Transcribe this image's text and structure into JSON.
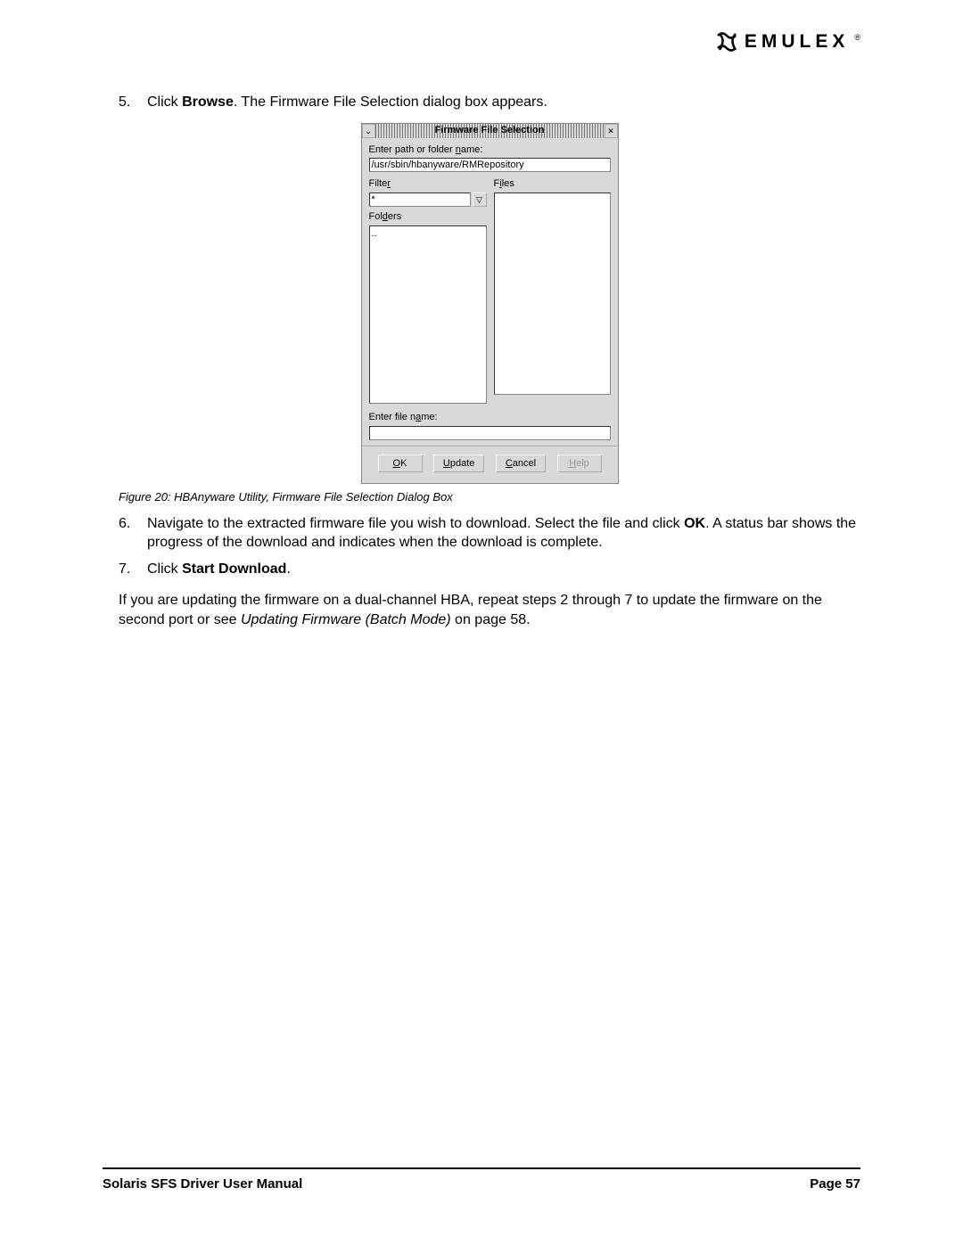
{
  "brand": {
    "name": "EMULEX",
    "reg": "®"
  },
  "steps": {
    "s5": {
      "num": "5.",
      "pre": "Click ",
      "bold": "Browse",
      "post": ". The Firmware File Selection dialog box appears."
    },
    "s6": {
      "num": "6.",
      "pre": "Navigate to the extracted firmware file you wish to download. Select the file and click ",
      "bold": "OK",
      "post": ". A status bar shows the progress of the download and indicates when the download is complete."
    },
    "s7": {
      "num": "7.",
      "pre": "Click ",
      "bold": "Start Download",
      "post": "."
    }
  },
  "dialog": {
    "title": "Firmware File Selection",
    "path_label_pre": "Enter path or folder ",
    "path_label_u": "n",
    "path_label_post": "ame:",
    "path_value": "/usr/sbin/hbanyware/RMRepository",
    "filter_label_pre": "Filte",
    "filter_label_u": "r",
    "filter_value": "*",
    "filter_btn": "▽",
    "folders_label_pre": "Fol",
    "folders_label_u": "d",
    "folders_label_post": "ers",
    "folders_content": "..",
    "files_label_pre": "F",
    "files_label_u": "i",
    "files_label_post": "les",
    "filename_label_pre": "Enter file n",
    "filename_label_u": "a",
    "filename_label_post": "me:",
    "filename_value": "",
    "buttons": {
      "ok_u": "O",
      "ok_post": "K",
      "update_u": "U",
      "update_post": "pdate",
      "cancel_u": "C",
      "cancel_post": "ancel",
      "help_u": "H",
      "help_post": "elp"
    },
    "sysmenu": "⌄",
    "close": "✕"
  },
  "caption": "Figure 20: HBAnyware Utility, Firmware File Selection Dialog Box",
  "trailer": {
    "pre": "If you are updating the firmware on a dual-channel HBA, repeat steps 2 through 7 to update the firmware on the second port or see ",
    "italic": "Updating Firmware (Batch Mode)",
    "post": " on page 58."
  },
  "footer": {
    "left": "Solaris SFS Driver User Manual",
    "right": "Page 57"
  }
}
